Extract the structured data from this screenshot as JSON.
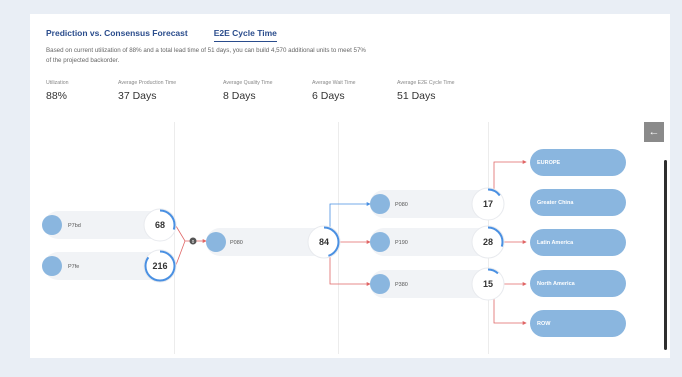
{
  "tabs": [
    {
      "label": "Prediction vs. Consensus Forecast",
      "active": false
    },
    {
      "label": "E2E Cycle Time",
      "active": true
    }
  ],
  "description": "Based on current utilization of 88% and a total lead time of 51 days, you can build 4,570 additional units to meet 57% of the projected backorder.",
  "metrics": [
    {
      "label": "Utilization",
      "value": "88%"
    },
    {
      "label": "Average Production Time",
      "value": "37 Days"
    },
    {
      "label": "Average Quality Time",
      "value": "8 Days"
    },
    {
      "label": "Average Wait Time",
      "value": "6 Days"
    },
    {
      "label": "Average E2E Cycle Time",
      "value": "51 Days"
    }
  ],
  "flow": {
    "sources": [
      {
        "label": "P7bd",
        "value": "68",
        "progress": 0.3
      },
      {
        "label": "P7fe",
        "value": "216",
        "progress": 0.85
      }
    ],
    "junction": {
      "label": "0"
    },
    "middle": {
      "label": "P080",
      "value": "84",
      "progress": 0.45
    },
    "plants": [
      {
        "label": "P080",
        "value": "17",
        "progress": 0.15
      },
      {
        "label": "P190",
        "value": "28",
        "progress": 0.3
      },
      {
        "label": "P380",
        "value": "15",
        "progress": 0.12
      }
    ],
    "regions": [
      "EUROPE",
      "Greater China",
      "Latin America",
      "North America",
      "ROW"
    ]
  },
  "controls": {
    "back_icon": "←"
  },
  "colors": {
    "node": "#8ab6df",
    "ring": "#4a90e2",
    "ring_alert": "#e84c4c",
    "link": "#e06666",
    "link_blue": "#4a90e2"
  }
}
